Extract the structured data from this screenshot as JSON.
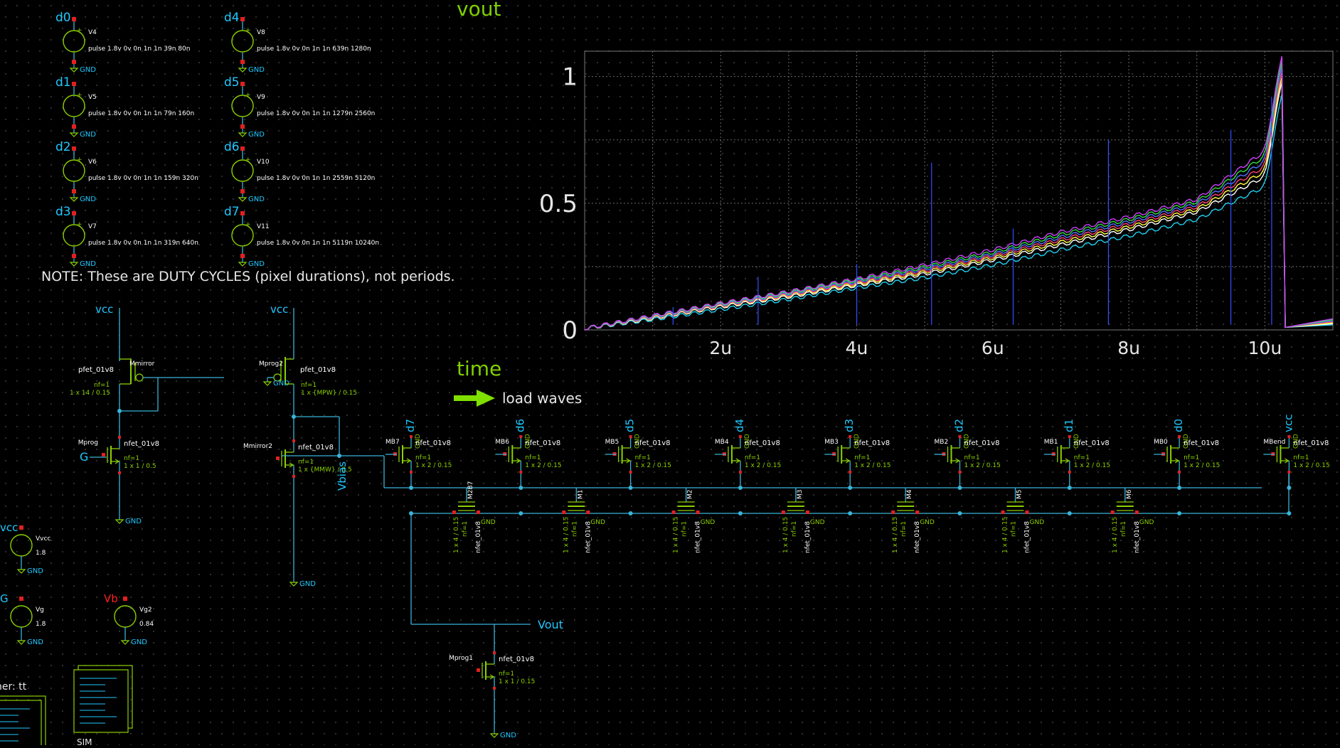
{
  "sources": [
    {
      "node": "d0",
      "name": "V4",
      "spec": "pulse 1.8v 0v 0n 1n 1n 39n 80n",
      "gnd": "GND"
    },
    {
      "node": "d1",
      "name": "V5",
      "spec": "pulse 1.8v 0v 0n 1n 1n 79n 160n",
      "gnd": "GND"
    },
    {
      "node": "d2",
      "name": "V6",
      "spec": "pulse 1.8v 0v 0n 1n 1n 159n 320n",
      "gnd": "GND"
    },
    {
      "node": "d3",
      "name": "V7",
      "spec": "pulse 1.8v 0v 0n 1n 1n 319n 640n",
      "gnd": "GND"
    },
    {
      "node": "d4",
      "name": "V8",
      "spec": "pulse 1.8v 0v 0n 1n 1n 639n 1280n",
      "gnd": "GND"
    },
    {
      "node": "d5",
      "name": "V9",
      "spec": "pulse 1.8v 0v 0n 1n 1n 1279n 2560n",
      "gnd": "GND"
    },
    {
      "node": "d6",
      "name": "V10",
      "spec": "pulse 1.8v 0v 0n 1n 1n 2559n 5120n",
      "gnd": "GND"
    },
    {
      "node": "d7",
      "name": "V11",
      "spec": "pulse 1.8v 0v 0n 1n 1n 5119n 10240n",
      "gnd": "GND"
    }
  ],
  "note": "NOTE: These are DUTY CYCLES (pixel durations), not periods.",
  "plot": {
    "ylabel": "vout",
    "xlabel": "time",
    "yticks": [
      "0",
      "0.5",
      "1"
    ],
    "xticks": [
      "2u",
      "4u",
      "6u",
      "8u",
      "10u"
    ],
    "load_waves": "load waves"
  },
  "chart_data": {
    "type": "line",
    "title": "",
    "xlabel": "time",
    "ylabel": "vout",
    "x_unit": "s",
    "xlim": [
      0,
      1.1e-05
    ],
    "ylim": [
      0,
      1.1
    ],
    "x_ticks": [
      "2u",
      "4u",
      "6u",
      "8u",
      "10u"
    ],
    "y_ticks": [
      0,
      0.5,
      1
    ],
    "grid": true,
    "x": [
      0,
      1,
      2,
      3,
      4,
      5,
      6,
      7,
      8,
      9,
      10,
      10.25,
      10.3,
      11
    ],
    "series": [
      {
        "color": "#20d0f0",
        "values": [
          0,
          0.035,
          0.075,
          0.115,
          0.16,
          0.2,
          0.25,
          0.31,
          0.365,
          0.43,
          0.56,
          0.93,
          0.01,
          0.02
        ]
      },
      {
        "color": "#ffffff",
        "values": [
          0,
          0.04,
          0.085,
          0.125,
          0.17,
          0.215,
          0.27,
          0.33,
          0.39,
          0.46,
          0.6,
          0.98,
          0.01,
          0.02
        ]
      },
      {
        "color": "#ffff40",
        "values": [
          0,
          0.042,
          0.088,
          0.13,
          0.175,
          0.222,
          0.278,
          0.34,
          0.4,
          0.47,
          0.62,
          1.0,
          0.01,
          0.02
        ]
      },
      {
        "color": "#ff4070",
        "values": [
          0,
          0.044,
          0.09,
          0.133,
          0.18,
          0.228,
          0.285,
          0.35,
          0.41,
          0.48,
          0.64,
          1.02,
          0.01,
          0.02
        ]
      },
      {
        "color": "#5070ff",
        "values": [
          0,
          0.046,
          0.093,
          0.137,
          0.185,
          0.235,
          0.292,
          0.36,
          0.42,
          0.49,
          0.66,
          1.04,
          0.01,
          0.02
        ]
      },
      {
        "color": "#30e040",
        "values": [
          0,
          0.048,
          0.096,
          0.141,
          0.19,
          0.242,
          0.3,
          0.37,
          0.43,
          0.5,
          0.68,
          1.06,
          0.01,
          0.02
        ]
      },
      {
        "color": "#d040ff",
        "values": [
          0,
          0.05,
          0.099,
          0.145,
          0.195,
          0.25,
          0.31,
          0.38,
          0.44,
          0.51,
          0.7,
          1.08,
          0.01,
          0.02
        ]
      }
    ]
  },
  "bias": {
    "vcc1": "vcc",
    "vcc2": "vcc",
    "mmirror": "Mmirror",
    "pfet": "pfet_01v8",
    "nfet": "nfet_01v8",
    "nf1": "nf=1",
    "mmirror_size": "1 x 14 / 0.15",
    "mprog2": "Mprog2",
    "mprog2_size": "1 x {MPW} / 0.15",
    "mprog": "Mprog",
    "mprog_size": "1 x 1 / 0.5",
    "G": "G",
    "mmirror2": "Mmirror2",
    "mmirror2_size": "1 x {MMW} / 0.5",
    "vbias": "Vbias",
    "gnd": "GND"
  },
  "supplies": [
    {
      "node": "vcc",
      "name": "Vvcc",
      "val": "1.8",
      "gnd": "GND",
      "color": "#20c8ff"
    },
    {
      "node": "G",
      "name": "Vg",
      "val": "1.8",
      "gnd": "GND",
      "color": "#20c8ff"
    },
    {
      "node": "Vb",
      "name": "Vg2",
      "val": "0.84",
      "gnd": "GND",
      "color": "#ff2020"
    }
  ],
  "ladder": {
    "top": [
      {
        "name": "MB7",
        "d": "d7"
      },
      {
        "name": "MB6",
        "d": "d6"
      },
      {
        "name": "MB5",
        "d": "d5"
      },
      {
        "name": "MB4",
        "d": "d4"
      },
      {
        "name": "MB3",
        "d": "d3"
      },
      {
        "name": "MB2",
        "d": "d2"
      },
      {
        "name": "MB1",
        "d": "d1"
      },
      {
        "name": "MB0",
        "d": "d0"
      },
      {
        "name": "MBend",
        "d": "vcc"
      }
    ],
    "nfet": "nfet_01v8",
    "nf1": "nf=1",
    "size": "1 x 2 / 0.15",
    "gnd": "GND",
    "bottom": [
      "M2B7",
      "M1",
      "M2",
      "M3",
      "M4",
      "M5",
      "M6"
    ],
    "bottom_size": "1 x 4 / 0.15",
    "vout": "Vout",
    "mprog1": "Mprog1",
    "mprog1_size": "1 x 1 / 0.15"
  },
  "corner": "ner: tt",
  "sim": "SIM"
}
